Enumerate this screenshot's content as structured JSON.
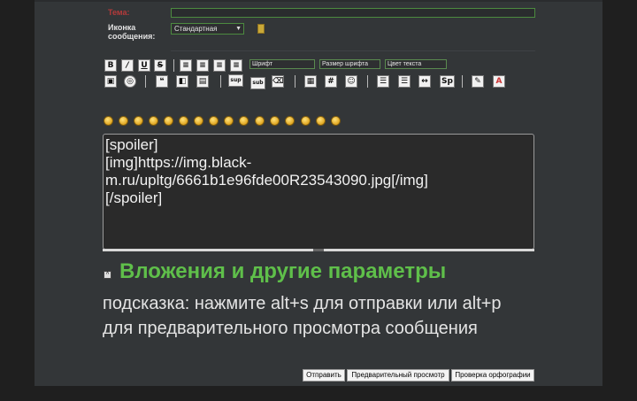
{
  "form": {
    "subject_label": "Тема:",
    "subject_value": "",
    "icon_label_line1": "Иконка",
    "icon_label_line2": "сообщения:",
    "icon_select_value": "Стандартная"
  },
  "toolbar": {
    "row1": [
      "B",
      "/",
      "U",
      "S"
    ],
    "font_select": "Шрифт",
    "size_select": "Размер шрифта",
    "color_select": "Цвет текста",
    "row2_labels": [
      "sup",
      "sub",
      "#",
      "Sp",
      "A"
    ]
  },
  "editor": {
    "lines": [
      "[spoiler]",
      "[img]https://img.black-",
      "m.ru/upltg/6661b1e96fde00R23543090.jpg[/img]",
      "[/spoiler]"
    ]
  },
  "attachments": {
    "title": "Вложения и другие параметры",
    "toggle_glyph": "^"
  },
  "hint": {
    "text": "подсказка: нажмите alt+s для отправки или alt+p для предварительного просмотра сообщения"
  },
  "buttons": {
    "submit": "Отправить",
    "preview": "Предварительный просмотр",
    "spellcheck": "Проверка орфографии"
  },
  "colors": {
    "accent_green": "#5fbf4a",
    "subject_label_red": "#b53a3a",
    "panel_bg": "#333638"
  }
}
